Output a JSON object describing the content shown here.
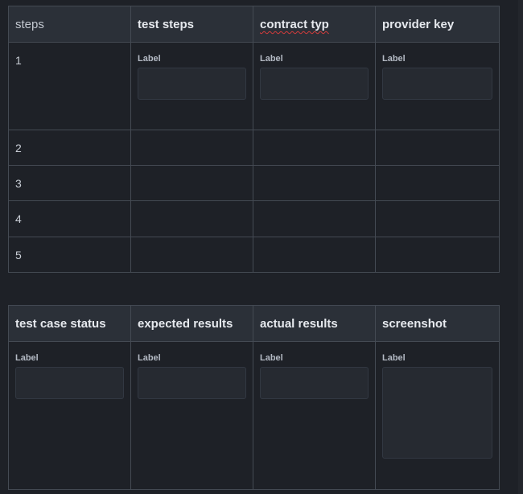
{
  "steps_table": {
    "headers": {
      "steps": "steps",
      "test_steps": "test steps",
      "contract_type": "contract typ",
      "provider_key": "provider key"
    },
    "rows": [
      {
        "num": "1",
        "test_steps_label": "Label",
        "contract_type_label": "Label",
        "provider_key_label": "Label"
      },
      {
        "num": "2"
      },
      {
        "num": "3"
      },
      {
        "num": "4"
      },
      {
        "num": "5"
      }
    ]
  },
  "results_table": {
    "headers": {
      "test_case_status": "test case status",
      "expected_results": "expected results",
      "actual_results": "actual results",
      "screenshot": "screenshot"
    },
    "row": {
      "test_case_status_label": "Label",
      "expected_results_label": "Label",
      "actual_results_label": "Label",
      "screenshot_label": "Label"
    }
  }
}
